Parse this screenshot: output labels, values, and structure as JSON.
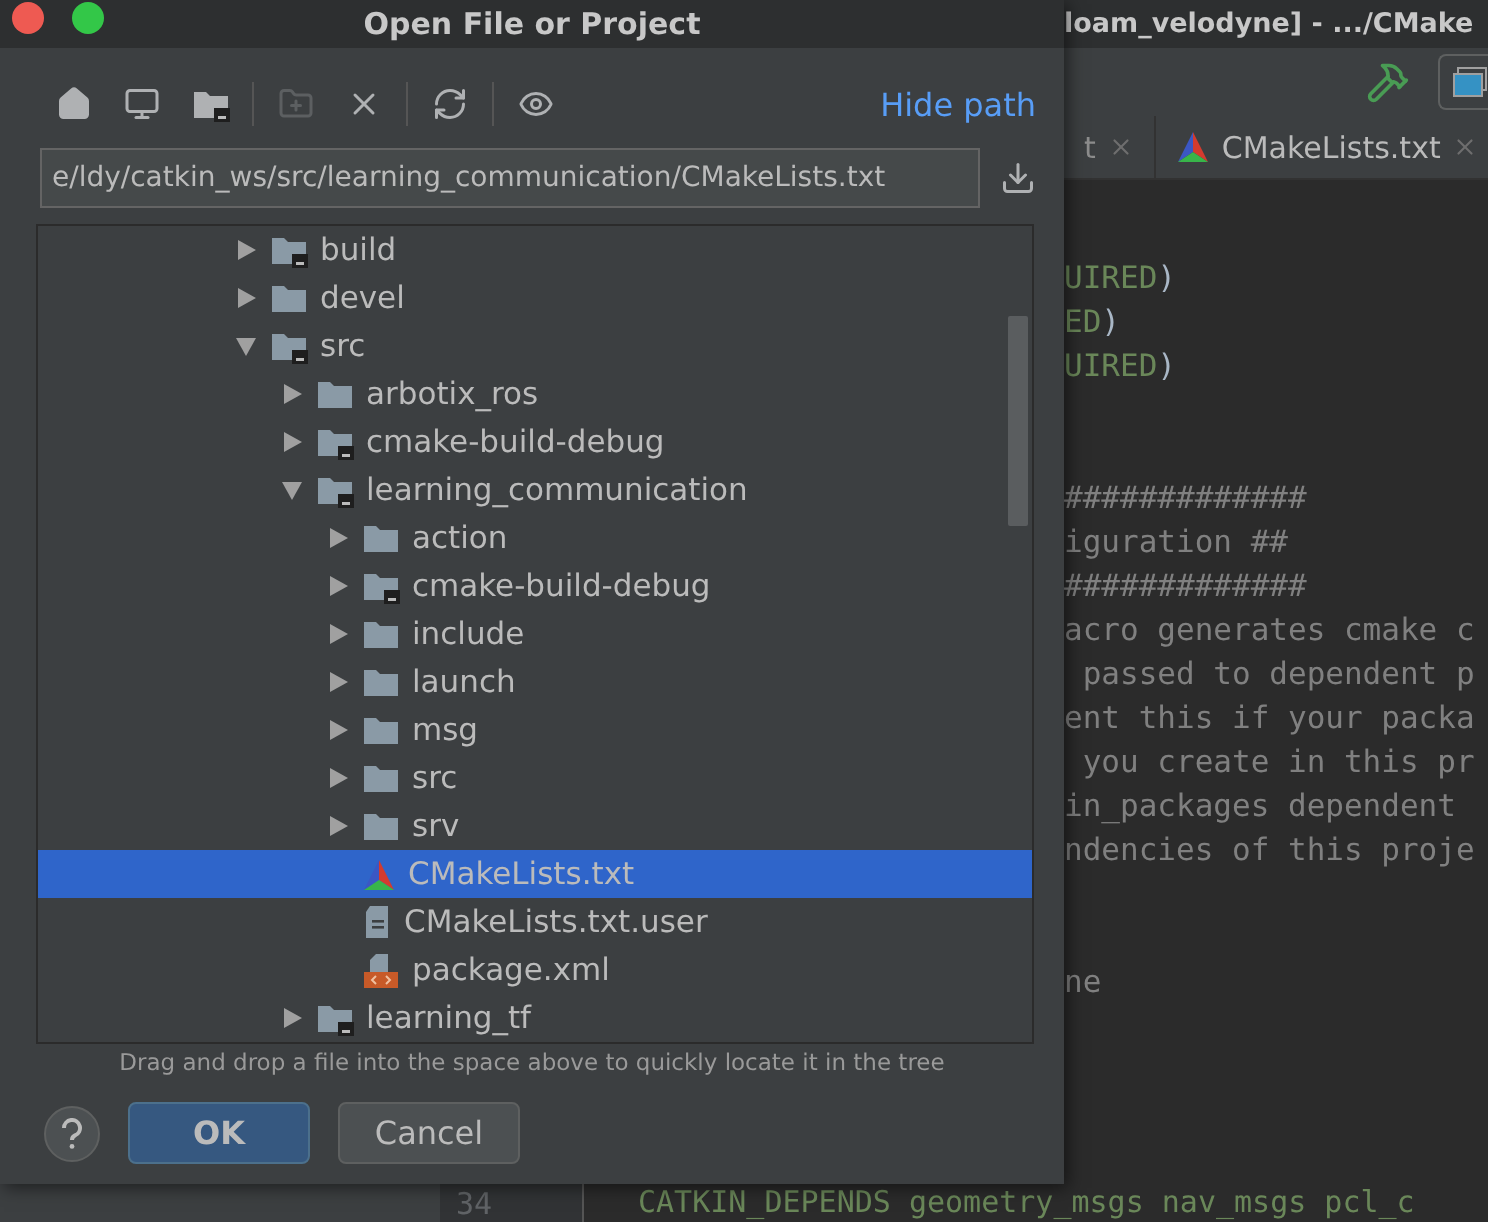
{
  "ide": {
    "title": "loam_velodyne] - .../CMake",
    "tabs": [
      {
        "label": "t",
        "kind": "plain"
      },
      {
        "label": "CMakeLists.txt",
        "kind": "cmake"
      }
    ],
    "code_blocks": [
      {
        "lines": [
          [
            {
              "text": "UIRED",
              "kind": "string"
            },
            {
              "text": ")",
              "kind": "paren"
            }
          ],
          [
            {
              "text": "ED",
              "kind": "string"
            },
            {
              "text": ")",
              "kind": "paren"
            }
          ],
          [
            {
              "text": "UIRED",
              "kind": "string"
            },
            {
              "text": ")",
              "kind": "paren"
            }
          ]
        ]
      },
      {
        "lines": [
          [
            {
              "text": "#############",
              "kind": "comment"
            }
          ],
          [
            {
              "text": "iguration ##",
              "kind": "comment"
            }
          ],
          [
            {
              "text": "#############",
              "kind": "comment"
            }
          ],
          [
            {
              "text": "acro generates cmake c",
              "kind": "comment"
            }
          ],
          [
            {
              "text": " passed to dependent p",
              "kind": "comment"
            }
          ],
          [
            {
              "text": "ent this if your packa",
              "kind": "comment"
            }
          ],
          [
            {
              "text": " you create in this pr",
              "kind": "comment"
            }
          ],
          [
            {
              "text": "in_packages dependent",
              "kind": "comment"
            }
          ],
          [
            {
              "text": "ndencies of this proje",
              "kind": "comment"
            }
          ]
        ]
      },
      {
        "lines": [
          [
            {
              "text": "ne",
              "kind": "comment"
            }
          ]
        ]
      }
    ],
    "bottom_line": {
      "number": "34",
      "code": "CATKIN_DEPENDS geometry_msgs nav_msgs pcl_c"
    }
  },
  "dialog": {
    "title": "Open File or Project",
    "toolbar_groups": [
      {
        "items": [
          {
            "kind": "home",
            "disabled": false
          },
          {
            "kind": "desktop",
            "disabled": false
          },
          {
            "kind": "project",
            "disabled": false
          }
        ]
      },
      {
        "items": [
          {
            "kind": "new_folder",
            "disabled": true
          },
          {
            "kind": "delete",
            "disabled": false
          }
        ]
      },
      {
        "items": [
          {
            "kind": "refresh",
            "disabled": false
          }
        ]
      },
      {
        "items": [
          {
            "kind": "show_hidden",
            "disabled": false
          }
        ]
      }
    ],
    "hide_path": "Hide path",
    "path": "e/ldy/catkin_ws/src/learning_communication/CMakeLists.txt",
    "tree": [
      {
        "label": "build",
        "kind": "module_folder",
        "expanded": false,
        "selected": false
      },
      {
        "label": "devel",
        "kind": "folder",
        "expanded": false,
        "selected": false
      },
      {
        "label": "src",
        "kind": "module_folder",
        "expanded": true,
        "selected": false,
        "children": [
          {
            "label": "arbotix_ros",
            "kind": "folder",
            "expanded": false,
            "selected": false
          },
          {
            "label": "cmake-build-debug",
            "kind": "module_folder",
            "expanded": false,
            "selected": false
          },
          {
            "label": "learning_communication",
            "kind": "module_folder",
            "expanded": true,
            "selected": false,
            "children": [
              {
                "label": "action",
                "kind": "folder",
                "expanded": false,
                "selected": false
              },
              {
                "label": "cmake-build-debug",
                "kind": "module_folder",
                "expanded": false,
                "selected": false
              },
              {
                "label": "include",
                "kind": "folder",
                "expanded": false,
                "selected": false
              },
              {
                "label": "launch",
                "kind": "folder",
                "expanded": false,
                "selected": false
              },
              {
                "label": "msg",
                "kind": "folder",
                "expanded": false,
                "selected": false
              },
              {
                "label": "src",
                "kind": "folder",
                "expanded": false,
                "selected": false
              },
              {
                "label": "srv",
                "kind": "folder",
                "expanded": false,
                "selected": false
              },
              {
                "label": "CMakeLists.txt",
                "kind": "cmake_file",
                "selected": true
              },
              {
                "label": "CMakeLists.txt.user",
                "kind": "text_file",
                "selected": false
              },
              {
                "label": "package.xml",
                "kind": "xml_file",
                "selected": false
              }
            ]
          },
          {
            "label": "learning_tf",
            "kind": "module_folder",
            "expanded": false,
            "selected": false
          }
        ]
      }
    ],
    "hint": "Drag and drop a file into the space above to quickly locate it in the tree",
    "buttons": [
      {
        "label": "OK",
        "kind": "primary"
      },
      {
        "label": "Cancel",
        "kind": "secondary"
      }
    ]
  }
}
